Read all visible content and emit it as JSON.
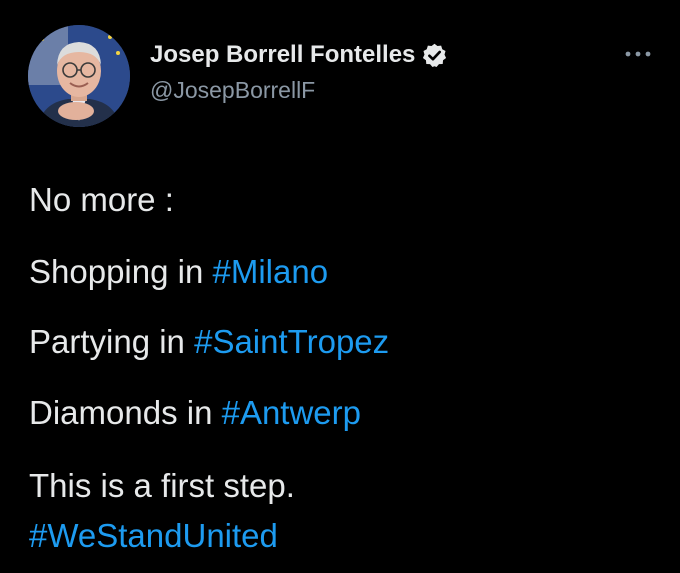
{
  "author": {
    "display_name": "Josep Borrell Fontelles",
    "handle": "@JosepBorrellF",
    "verified": true,
    "avatar_icon": "user-avatar-photo",
    "verified_icon": "verified-badge-icon",
    "more_icon": "more-options-icon"
  },
  "tweet": {
    "lines": [
      {
        "text": "No more :",
        "hashtag": ""
      },
      {
        "text": "Shopping in ",
        "hashtag": "#Milano"
      },
      {
        "text": "Partying in ",
        "hashtag": "#SaintTropez"
      },
      {
        "text": "Diamonds in ",
        "hashtag": "#Antwerp"
      },
      {
        "text": "This is a first step.",
        "hashtag": ""
      },
      {
        "text": "",
        "hashtag": "#WeStandUnited"
      }
    ]
  },
  "colors": {
    "background": "#000000",
    "text": "#e7e9ea",
    "secondary_text": "#8b98a5",
    "link": "#1d9bf0"
  }
}
